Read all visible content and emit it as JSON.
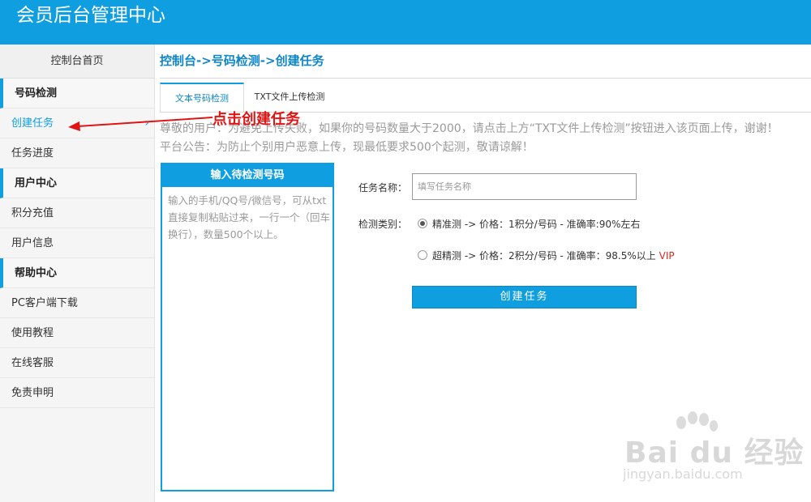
{
  "header": {
    "title": "会员后台管理中心"
  },
  "sidebar": {
    "home": "控制台首页",
    "sections": [
      {
        "title": "号码检测",
        "items": [
          "创建任务",
          "任务进度"
        ]
      },
      {
        "title": "用户中心",
        "items": [
          "积分充值",
          "用户信息"
        ]
      },
      {
        "title": "帮助中心",
        "items": [
          "PC客户端下载",
          "使用教程",
          "在线客服",
          "免责申明"
        ]
      }
    ],
    "chevron": "›"
  },
  "breadcrumb": "控制台->号码检测->创建任务",
  "tabs": [
    "文本号码检测",
    "TXT文件上传检测"
  ],
  "notices": [
    "尊敬的用户：为避免上传失败，如果你的号码数量大于2000，请点击上方“TXT文件上传检测”按钮进入该页面上传，谢谢！",
    "平台公告：为防止个别用户恶意上传，现最低要求500个起测，敬请谅解！"
  ],
  "input_panel": {
    "title": "输入待检测号码",
    "placeholder": "输入的手机/QQ号/微信号，可从txt直接复制粘贴过来，一行一个（回车换行），数量500个以上。"
  },
  "form": {
    "task_name_label": "任务名称：",
    "task_name_placeholder": "填写任务名称",
    "type_label": "检测类别：",
    "options": [
      {
        "text": "精准测 -> 价格：1积分/号码 - 准确率:90%左右",
        "checked": true
      },
      {
        "text": "超精测 -> 价格：2积分/号码 - 准确率：98.5%以上",
        "badge": "VIP",
        "checked": false
      }
    ],
    "submit": "创建任务"
  },
  "annotation": {
    "text": "点击创建任务",
    "color": "#e11414"
  },
  "watermark": {
    "brand": "Bai du 经验",
    "url": "jingyan.baidu.com"
  },
  "colors": {
    "accent": "#0f9ee0",
    "vip": "#e0281e"
  }
}
